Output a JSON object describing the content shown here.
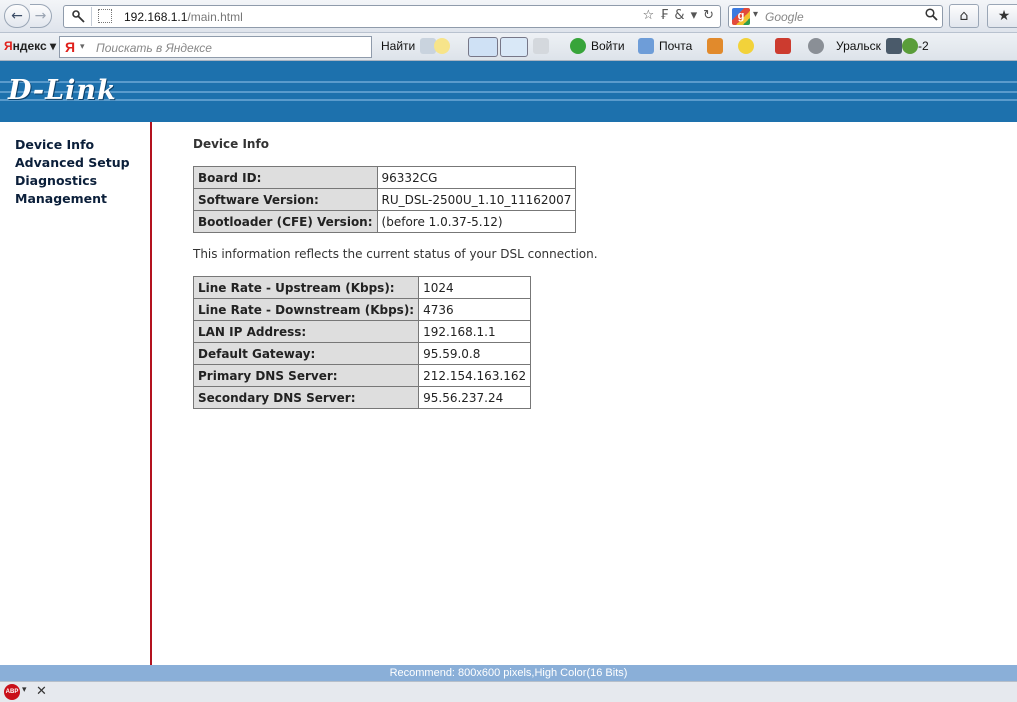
{
  "browser": {
    "url_host": "192.168.1.1",
    "url_path": "/main.html",
    "search_placeholder": "Google",
    "back_glyph": "←",
    "forward_glyph": "→",
    "home_glyph": "⌂",
    "bookmark_glyph": "★"
  },
  "yandex_toolbar": {
    "brand_first": "Я",
    "brand_rest": "ндекс",
    "search_placeholder": "Поискать в Яндексе",
    "find_label": "Найти",
    "login_label": "Войти",
    "mail_label": "Почта",
    "city_label": "Уральск",
    "temperature": "-2"
  },
  "header": {
    "logo_text": "D-Link"
  },
  "sidebar": {
    "items": [
      {
        "label": "Device Info"
      },
      {
        "label": "Advanced Setup"
      },
      {
        "label": "Diagnostics"
      },
      {
        "label": "Management"
      }
    ]
  },
  "main": {
    "title": "Device Info",
    "board_table": [
      {
        "label": "Board ID:",
        "value": "96332CG"
      },
      {
        "label": "Software Version:",
        "value": "RU_DSL-2500U_1.10_11162007"
      },
      {
        "label": "Bootloader (CFE) Version:",
        "value": "(before 1.0.37-5.12)"
      }
    ],
    "status_note": "This information reflects the current status of your DSL connection.",
    "dsl_table": [
      {
        "label": "Line Rate - Upstream (Kbps):",
        "value": "1024"
      },
      {
        "label": "Line Rate - Downstream (Kbps):",
        "value": "4736"
      },
      {
        "label": "LAN IP Address:",
        "value": "192.168.1.1"
      },
      {
        "label": "Default Gateway:",
        "value": "95.59.0.8"
      },
      {
        "label": "Primary DNS Server:",
        "value": "212.154.163.162"
      },
      {
        "label": "Secondary DNS Server:",
        "value": "95.56.237.24"
      }
    ]
  },
  "footer": {
    "recommend": "Recommend: 800x600 pixels,High Color(16 Bits)"
  },
  "statusbar": {
    "abp_text": "ABP",
    "close_glyph": "✕"
  },
  "colors": {
    "header_blue": "#1d71ad",
    "sidebar_border": "#b3121f",
    "recommend_bar": "#8aafd8"
  }
}
